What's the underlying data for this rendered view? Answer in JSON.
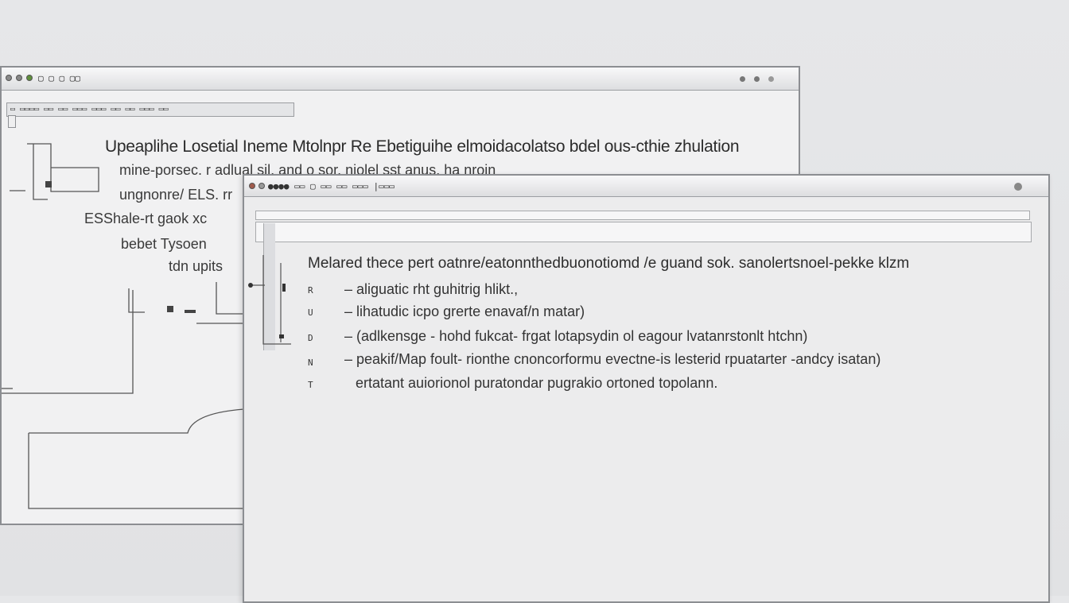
{
  "back_window": {
    "title": "▢ ▢ ▢ ▢▢",
    "toolbar": "▭ ▭▭▭▭ ▭▭ ▭▭ ▭▭▭ ▭▭▭ ▭▭ ▭▭ ▭▭▭ ▭▭",
    "heading": "Upeaplihe Losetial Ineme Mtolnpr Re Ebetiguihe elmoidacolatso bdel ous-cthie zhulation",
    "lines": [
      "mine-porsec. r adlual sil, and o sor. niolel sst anus. ha nroin",
      "ungnonre/ ELS. rr",
      "ESShale-rt gaok xc",
      "bebet Tysoen",
      "tdn upits"
    ]
  },
  "front_window": {
    "title": "●●●● ▭▭ ▢ ▭▭ ▭▭ ▭▭▭ |▭▭▭",
    "heading": "Melared thece pert oatnre/eatonnthedbuonotiomd /e guand sok. sanolertsnoel-pekke klzm",
    "rows": [
      {
        "marker": "R",
        "text": "– aliguatic rht guhitrig hlikt.,"
      },
      {
        "marker": "U",
        "text": "– lihatudic icpo grerte enavaf/n matar)"
      },
      {
        "marker": "D",
        "text": "– (adlkensge - hohd fukcat- frgat lotapsydin ol eagour lvatanrstonlt htchn)"
      },
      {
        "marker": "N",
        "text": "– peakif/Map foult- rionthe cnoncorformu evectne-is lesterid rpuatarter -andcy isatan)"
      },
      {
        "marker": "T",
        "text": "ertatant auiorionol puratondar pugrakio ortoned topolann."
      }
    ]
  },
  "colors": {
    "background": "#e4e5e7",
    "window_border": "#8c8e92",
    "window_fill": "#f1f1f2",
    "text": "#2b2b2b"
  },
  "icons": [
    "close-dot",
    "minimize-dot",
    "zoom-dot",
    "window-control-icon"
  ]
}
